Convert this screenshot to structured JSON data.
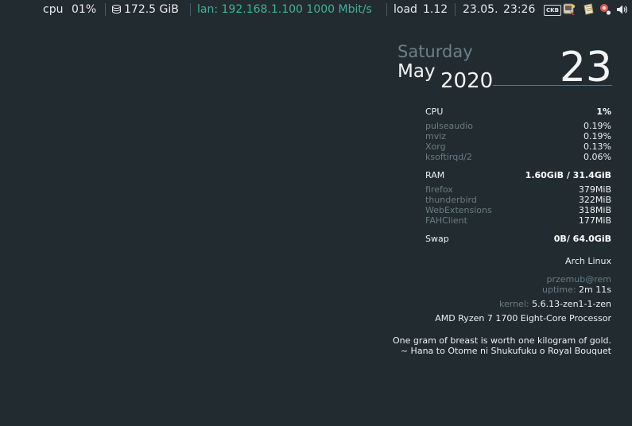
{
  "statusbar": {
    "cpu_label": "cpu",
    "cpu_value": "01%",
    "disk_value": "172.5 GiB",
    "lan_label": "lan:",
    "lan_ip": "192.168.1.100",
    "lan_speed": "1000 Mbit/s",
    "load_label": "load",
    "load_value": "1.12",
    "date": "23.05.",
    "time": "23:26",
    "keyboard_layout": "CKB",
    "tray_icons": [
      "keyboard-layout-icon",
      "pidgin-icon",
      "notes-icon",
      "network-icon",
      "volume-icon"
    ],
    "colors": {
      "lan": "#3fb19a",
      "text": "#e8eaeb",
      "background": "#222b30"
    }
  },
  "conky": {
    "date": {
      "weekday": "Saturday",
      "month": "May",
      "year": "2020",
      "day": "23"
    },
    "cpu": {
      "label": "CPU",
      "value": "1%",
      "processes": [
        {
          "name": "pulseaudio",
          "value": "0.19%"
        },
        {
          "name": "mviz",
          "value": "0.19%"
        },
        {
          "name": "Xorg",
          "value": "0.13%"
        },
        {
          "name": "ksoftirqd/2",
          "value": "0.06%"
        }
      ]
    },
    "ram": {
      "label": "RAM",
      "value": "1.60GiB / 31.4GiB",
      "processes": [
        {
          "name": "firefox",
          "value": "379MiB"
        },
        {
          "name": "thunderbird",
          "value": "322MiB"
        },
        {
          "name": "WebExtensions",
          "value": "318MiB"
        },
        {
          "name": "FAHClient",
          "value": "177MiB"
        }
      ]
    },
    "swap": {
      "label": "Swap",
      "value": "0B/ 64.0GiB"
    },
    "system": {
      "distro": "Arch Linux",
      "user_host": "przemub@rem",
      "uptime_label": "uptime:",
      "uptime_value": "2m 11s",
      "kernel_label": "kernel:",
      "kernel_value": "5.6.13-zen1-1-zen",
      "cpu_model": "AMD Ryzen 7 1700 Eight-Core Processor"
    },
    "quote": {
      "text": "One gram of breast is worth one kilogram of gold.",
      "source": "~ Hana to Otome ni Shukufuku o Royal Bouquet"
    }
  }
}
